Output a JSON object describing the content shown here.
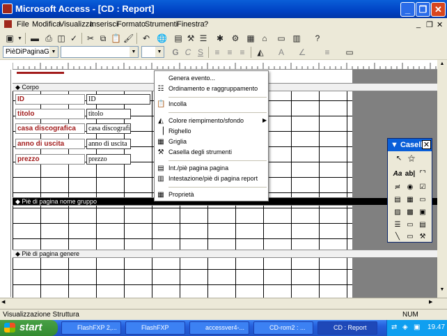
{
  "window": {
    "title": "Microsoft Access - [CD : Report]",
    "btn_min": "_",
    "btn_max": "❐",
    "btn_close": "✕"
  },
  "menu": [
    {
      "label": "File"
    },
    {
      "label": "Modifica"
    },
    {
      "label": "Visualizza"
    },
    {
      "label": "Inserisci"
    },
    {
      "label": "Formato"
    },
    {
      "label": "Strumenti"
    },
    {
      "label": "Finestra"
    },
    {
      "label": "?"
    }
  ],
  "mdi_controls": [
    "_",
    "❐",
    "✕"
  ],
  "format_toolbar": {
    "object_combo": "PièDiPaginaGru",
    "font_combo": "",
    "size_combo": "",
    "bold": "G",
    "italic": "C",
    "underline": "S"
  },
  "sections": {
    "corpo": "Corpo",
    "pie_gruppo": "Piè di pagina nome gruppo",
    "pie_genere": "Piè di pagina genere"
  },
  "fields": [
    {
      "label": "ID",
      "control": "ID"
    },
    {
      "label": "titolo",
      "control": "titolo"
    },
    {
      "label": "casa discografica",
      "control": "casa discografica"
    },
    {
      "label": "anno di uscita",
      "control": "anno di uscita"
    },
    {
      "label": "prezzo",
      "control": "prezzo"
    }
  ],
  "context_menu": [
    {
      "label": "Genera evento...",
      "icon": "event-icon"
    },
    {
      "label": "Ordinamento e raggruppamento",
      "icon": "sorting-grouping-icon"
    },
    {
      "label": "Incolla",
      "icon": "paste-icon"
    },
    {
      "label": "Colore riempimento/sfondo",
      "icon": "fill-color-icon",
      "submenu": true
    },
    {
      "label": "Righello",
      "icon": "ruler-icon"
    },
    {
      "label": "Griglia",
      "icon": "grid-icon"
    },
    {
      "label": "Casella degli strumenti",
      "icon": "toolbox-icon"
    },
    {
      "label": "Int./piè pagina pagina",
      "icon": "page-header-icon"
    },
    {
      "label": "Intestazione/piè di pagina report",
      "icon": "report-header-icon"
    },
    {
      "label": "Proprietà",
      "icon": "properties-icon"
    }
  ],
  "toolbox": {
    "title": "Casella"
  },
  "status": {
    "left": "Visualizzazione Struttura",
    "right": "NUM"
  },
  "taskbar": {
    "start": "start",
    "items": [
      {
        "label": "FlashFXP 2,..."
      },
      {
        "label": "FlashFXP"
      },
      {
        "label": "accessver4-..."
      },
      {
        "label": "CD-rom2 : ..."
      },
      {
        "label": "CD : Report"
      }
    ],
    "clock": "19.47"
  },
  "colors": {
    "label_text": "#a21b1b",
    "titlebar": "#0a5fd8",
    "taskbar": "#245edb",
    "start": "#338b31"
  }
}
